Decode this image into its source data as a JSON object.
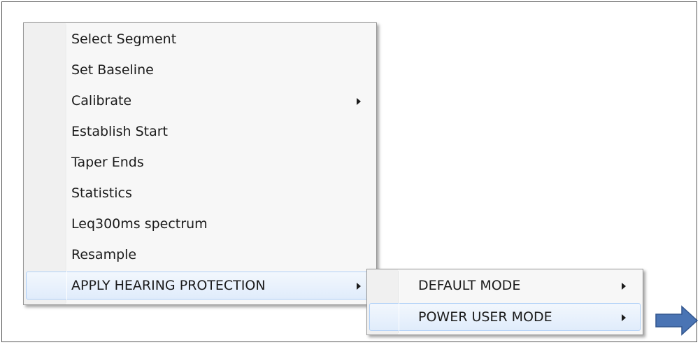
{
  "main_menu": {
    "items": [
      {
        "label": "Select Segment",
        "submenu": false
      },
      {
        "label": "Set Baseline",
        "submenu": false
      },
      {
        "label": "Calibrate",
        "submenu": true
      },
      {
        "label": "Establish Start",
        "submenu": false
      },
      {
        "label": "Taper Ends",
        "submenu": false
      },
      {
        "label": "Statistics",
        "submenu": false
      },
      {
        "label": "Leq300ms spectrum",
        "submenu": false
      },
      {
        "label": "Resample",
        "submenu": false
      },
      {
        "label": "APPLY HEARING PROTECTION",
        "submenu": true,
        "highlighted": true
      }
    ]
  },
  "sub_menu": {
    "items": [
      {
        "label": "DEFAULT MODE",
        "submenu": true
      },
      {
        "label": "POWER USER MODE",
        "submenu": true,
        "highlighted": true
      }
    ]
  },
  "icons": {
    "submenu_arrow": "chevron-right-icon",
    "callout": "right-arrow-icon"
  },
  "colors": {
    "highlight_border": "#aecff7",
    "highlight_fill": "#e0ecfb",
    "callout_arrow": "#4a74b4"
  }
}
